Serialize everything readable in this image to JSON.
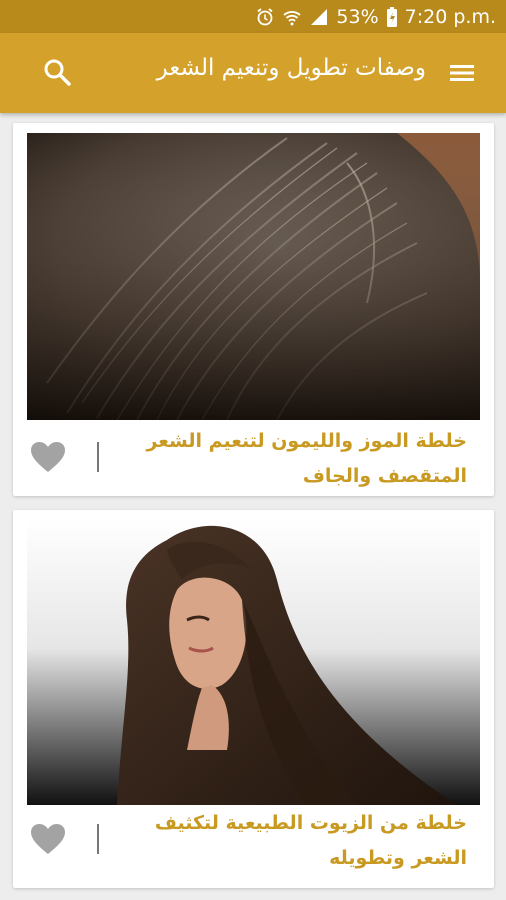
{
  "status_bar": {
    "battery_percent": "53%",
    "time": "7:20 p.m.",
    "icons": [
      "alarm-icon",
      "wifi-icon",
      "signal-icon",
      "battery-icon"
    ]
  },
  "app_bar": {
    "title": "وصفات تطويل وتنعيم الشعر",
    "menu_icon": "hamburger-menu-icon",
    "search_icon": "search-icon"
  },
  "articles": [
    {
      "title": "خلطة الموز والليمون لتنعيم الشعر المتقصف والجاف",
      "image": "hair-scalp-photo"
    },
    {
      "title": "خلطة من الزيوت الطبيعية لتكثيف الشعر وتطويله",
      "image": "woman-long-hair-photo"
    }
  ],
  "colors": {
    "status_bar": "#b88a1c",
    "app_bar": "#d4a12a",
    "accent_text": "#c99a22",
    "background": "#ededed"
  }
}
